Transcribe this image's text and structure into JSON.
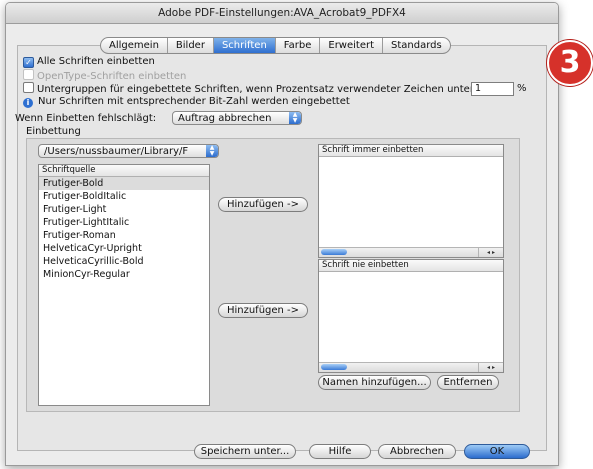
{
  "window": {
    "title": "Adobe PDF-Einstellungen:AVA_Acrobat9_PDFX4"
  },
  "tabs": [
    {
      "label": "Allgemein"
    },
    {
      "label": "Bilder"
    },
    {
      "label": "Schriften",
      "active": true
    },
    {
      "label": "Farbe"
    },
    {
      "label": "Erweitert"
    },
    {
      "label": "Standards"
    }
  ],
  "options": {
    "embed_all": {
      "label": "Alle Schriften einbetten",
      "checked": true
    },
    "opentype": {
      "label": "OpenType-Schriften einbetten",
      "checked": false,
      "disabled": true
    },
    "subset": {
      "label": "Untergruppen für eingebettete Schriften, wenn Prozentsatz verwendeter Zeichen unter:",
      "checked": false,
      "value": "1",
      "unit": "%"
    },
    "info": "Nur Schriften mit entsprechender Bit-Zahl werden eingebettet"
  },
  "fail": {
    "label": "Wenn Einbetten fehlschlägt:",
    "value": "Auftrag abbrechen"
  },
  "embedding": {
    "group_label": "Einbettung",
    "source_path": "/Users/nussbaumer/Library/F",
    "source_header": "Schriftquelle",
    "fonts": [
      "Frutiger-Bold",
      "Frutiger-BoldItalic",
      "Frutiger-Light",
      "Frutiger-LightItalic",
      "Frutiger-Roman",
      "HelveticaCyr-Upright",
      "HelveticaCyrillic-Bold",
      "MinionCyr-Regular"
    ],
    "add_label_1": "Hinzufügen ->",
    "add_label_2": "Hinzufügen ->",
    "always_header": "Schrift immer einbetten",
    "never_header": "Schrift nie einbetten",
    "add_names_label": "Namen hinzufügen...",
    "remove_label": "Entfernen"
  },
  "footer": {
    "save_as": "Speichern unter...",
    "help": "Hilfe",
    "cancel": "Abbrechen",
    "ok": "OK"
  },
  "badge": {
    "number": "3",
    "color": "#d6312a"
  },
  "icons": {
    "info": "info-icon",
    "popup": "popup-arrows-icon",
    "check": "checkmark-icon"
  }
}
